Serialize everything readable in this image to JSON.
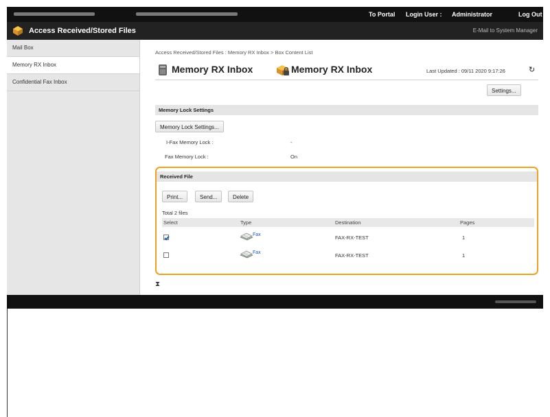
{
  "topbar": {
    "portal_label": "To Portal",
    "login_user_label": "Login User :",
    "user_name": "Administrator",
    "logout_label": "Log Out"
  },
  "titlebar": {
    "title": "Access Received/Stored Files",
    "mail_link": "E-Mail to System Manager"
  },
  "sidebar": {
    "items": [
      {
        "label": "Mail Box"
      },
      {
        "label": "Memory RX Inbox"
      },
      {
        "label": "Confidential Fax Inbox"
      }
    ]
  },
  "main": {
    "breadcrumb": "Access Received/Stored Files : Memory RX Inbox > Box Content List",
    "title": "Memory RX Inbox",
    "title_repeat": "Memory RX Inbox",
    "last_updated": "Last Updated : 09/11 2020 9:17:26",
    "settings_button": "Settings..."
  },
  "memory_lock": {
    "section_title": "Memory Lock Settings",
    "settings_button": "Memory Lock Settings...",
    "ifax_label": "I-Fax Memory Lock :",
    "ifax_value": "-",
    "fax_label": "Fax Memory Lock :",
    "fax_value": "On"
  },
  "received": {
    "section_title": "Received File",
    "buttons": {
      "print": "Print...",
      "send": "Send...",
      "delete": "Delete"
    },
    "total": "Total 2 files",
    "columns": {
      "select": "Select",
      "type": "Type",
      "destination": "Destination",
      "pages": "Pages"
    },
    "rows": [
      {
        "selected": true,
        "type": "Fax",
        "destination": "FAX-RX-TEST",
        "pages": "1"
      },
      {
        "selected": false,
        "type": "Fax",
        "destination": "FAX-RX-TEST",
        "pages": "1"
      }
    ]
  },
  "colors": {
    "highlight": "#f0a020",
    "link": "#1a58b3",
    "header_bg": "#111111"
  }
}
